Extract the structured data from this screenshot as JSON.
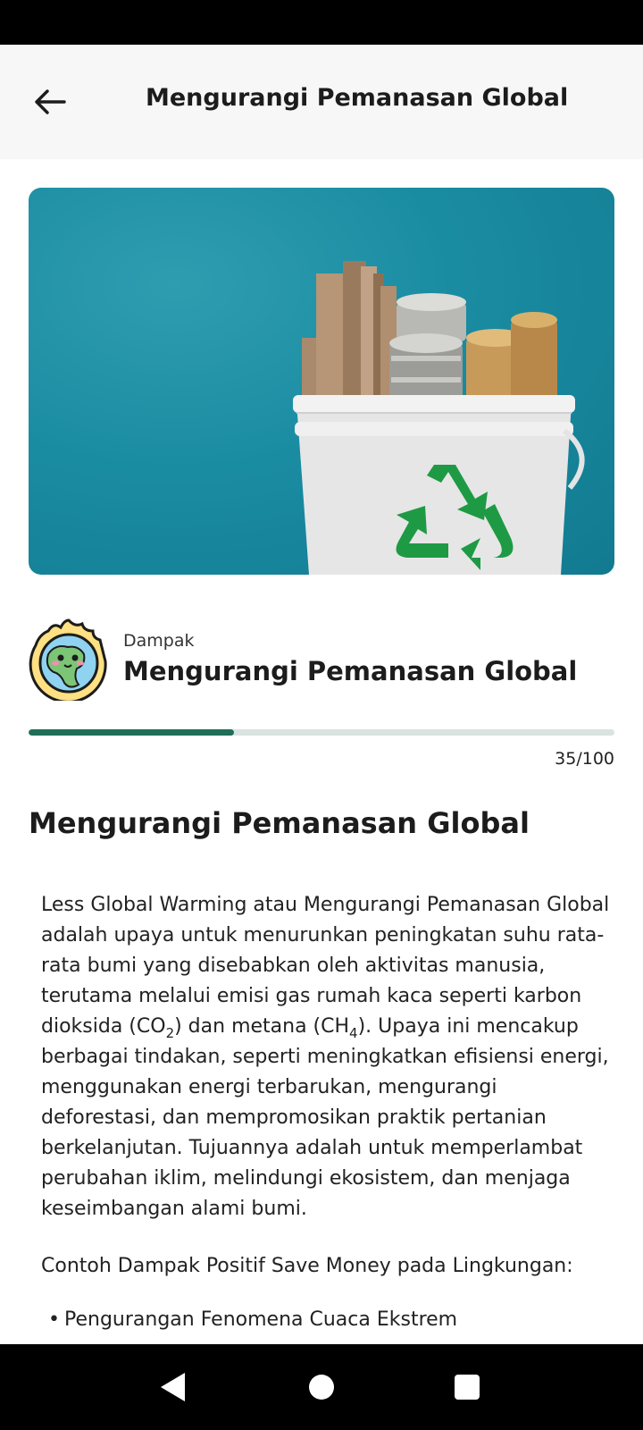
{
  "app_bar": {
    "back_icon": "arrow-left-icon",
    "title": "Mengurangi Pemanasan Global"
  },
  "hero": {
    "icon": "recycle-icon"
  },
  "topic": {
    "category": "Dampak",
    "name": "Mengurangi Pemanasan Global"
  },
  "progress": {
    "label": "35/100",
    "fraction": 0.35
  },
  "article": {
    "heading": "Mengurangi Pemanasan Global",
    "para1_a": "Less Global Warming atau Mengurangi Pemanasan Global adalah upaya untuk menurunkan peningkatan suhu rata-rata bumi yang disebabkan oleh aktivitas manusia, terutama melalui emisi gas rumah kaca seperti karbon dioksida (CO",
    "para1_sub1": "2",
    "para1_b": ") dan metana (CH",
    "para1_sub2": "4",
    "para1_c": "). Upaya ini mencakup berbagai tindakan, seperti meningkatkan efisiensi energi, menggunakan energi terbarukan, mengurangi deforestasi, dan mempromosikan praktik pertanian berkelanjutan. Tujuannya adalah untuk memperlambat perubahan iklim, melindungi ekosistem, dan menjaga keseimbangan alami bumi.",
    "para2": "Contoh Dampak Positif Save Money pada Lingkungan:",
    "bullets": [
      "Pengurangan Fenomena Cuaca Ekstrem"
    ]
  },
  "nav": {
    "back": "nav-back-icon",
    "home": "nav-home-icon",
    "recents": "nav-recents-icon"
  },
  "colors": {
    "accent": "#1f6e57",
    "track": "#d9e3e0",
    "hero_bg": "#1a8ca2",
    "recycle": "#1e9a44"
  }
}
